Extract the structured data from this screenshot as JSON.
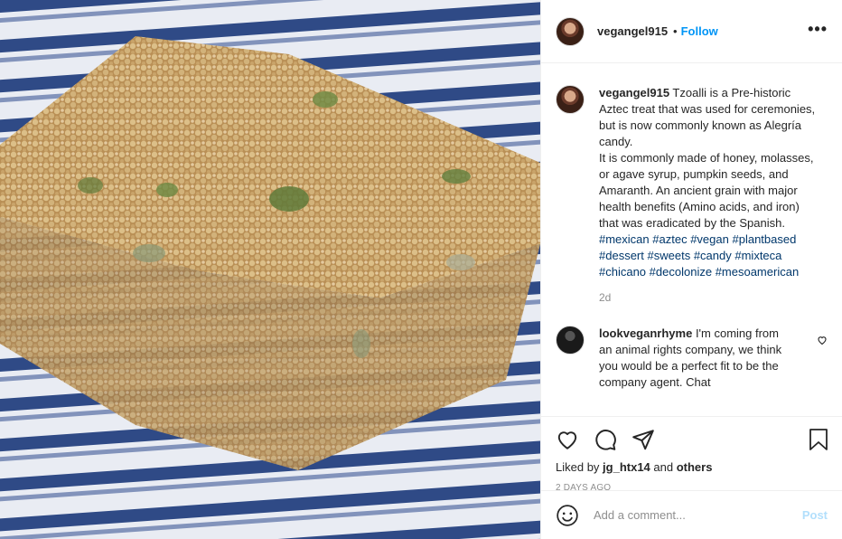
{
  "photo": {
    "description_icon": "photo-image",
    "colors": {
      "cloth_blue": "#2f4a86",
      "cloth_white": "#e9ecf3",
      "candy": "#c9a062"
    }
  },
  "header": {
    "username": "vegangel915",
    "separator": "•",
    "follow_label": "Follow",
    "more_label": "•••"
  },
  "caption": {
    "username": "vegangel915",
    "text_1": " Tzoalli is a Pre-historic Aztec treat that was used for ceremonies, but is now commonly known as Alegría candy.",
    "text_2": "It is commonly made of honey, molasses, or agave syrup, pumpkin seeds, and Amaranth. An ancient grain with major health benefits (Amino acids, and iron) that was eradicated by the Spanish.",
    "hashtags": [
      "#mexican",
      "#aztec",
      "#vegan",
      "#plantbased",
      "#dessert",
      "#sweets",
      "#candy",
      "#mixteca",
      "#chicano",
      "#decolonize",
      "#mesoamerican"
    ],
    "time": "2d"
  },
  "comment": {
    "username": "lookveganrhyme",
    "text": " I'm coming from an animal rights company, we think you would be a perfect fit to be the company agent. Chat"
  },
  "actions": {
    "liked_prefix": "Liked by ",
    "liked_user": "jg_htx14",
    "liked_and": " and ",
    "liked_others": "others",
    "ago": "2 DAYS AGO"
  },
  "add_comment": {
    "placeholder": "Add a comment...",
    "post_label": "Post"
  },
  "colors": {
    "link": "#0095f6",
    "hashtag": "#00376b",
    "muted": "#8e8e8e",
    "post_disabled": "#b2dffc"
  }
}
